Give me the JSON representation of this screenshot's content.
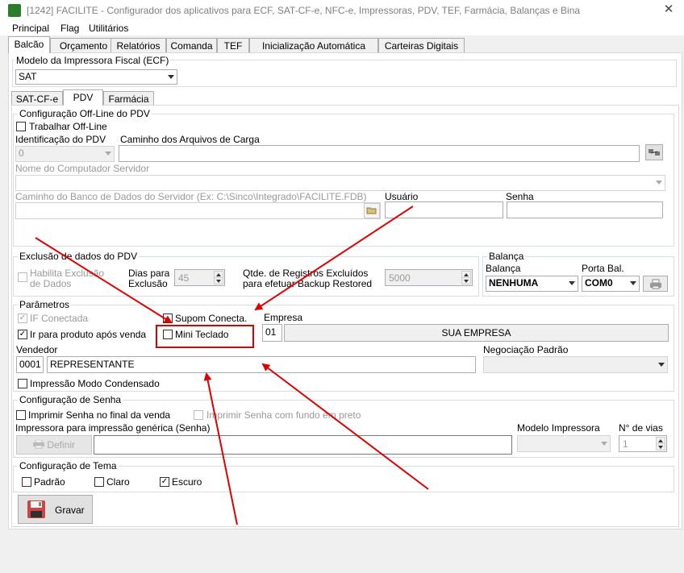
{
  "window": {
    "title": "[1242] FACILITE - Configurador dos aplicativos para ECF, SAT-CF-e, NFC-e, Impressoras, PDV, TEF, Farmácia, Balanças e Bina",
    "close": "✕"
  },
  "menu": [
    "Principal",
    "Flag",
    "Utilitários"
  ],
  "tabs": [
    "Balcão",
    "Orçamento",
    "Relatórios",
    "Comanda",
    "TEF",
    "Inicialização Automática",
    "Carteiras Digitais"
  ],
  "modelo_fiscal": {
    "label": "Modelo da Impressora Fiscal (ECF)",
    "value": "SAT"
  },
  "subtabs": [
    "SAT-CF-e",
    "PDV",
    "Farmácia"
  ],
  "offline": {
    "legend": "Configuração Off-Line do PDV",
    "trabalhar_label": "Trabalhar Off-Line",
    "id_pdv_label": "Identificação do PDV",
    "id_pdv_value": "0",
    "caminho_carga_label": "Caminho dos Arquivos de Carga",
    "nome_servidor_label": "Nome do Computador Servidor",
    "caminho_banco_label": "Caminho do Banco de Dados do Servidor (Ex: C:\\Sinco\\Integrado\\FACILITE.FDB)",
    "usuario_label": "Usuário",
    "senha_label": "Senha"
  },
  "exclusao": {
    "legend": "Exclusão de dados do PDV",
    "habilita_label_1": "Habilita Exclusão",
    "habilita_label_2": "de Dados",
    "dias_label_1": "Dias para",
    "dias_label_2": "Exclusão",
    "dias_value": "45",
    "qtde_label_1": "Qtde. de Registros Excluídos",
    "qtde_label_2": "para efetuar Backup Restored",
    "qtde_value": "5000"
  },
  "balanca": {
    "legend": "Balança",
    "balanca_label": "Balança",
    "balanca_value": "NENHUMA",
    "porta_label": "Porta Bal.",
    "porta_value": "COM0"
  },
  "parametros": {
    "legend": "Parâmetros",
    "if_conectada": "IF Conectada",
    "supom_conecta": "Supom Conecta.",
    "ir_produto": "Ir para produto após venda",
    "mini_teclado": "Mini Teclado",
    "empresa_label": "Empresa",
    "empresa_code": "01",
    "empresa_name": "SUA EMPRESA",
    "vendedor_label": "Vendedor",
    "vendedor_code": "0001",
    "vendedor_name": "REPRESENTANTE",
    "negociacao_label": "Negociação Padrão",
    "impressao_condensado": "Impressão Modo Condensado"
  },
  "senha_cfg": {
    "legend": "Configuração de Senha",
    "imprimir_final": "Imprimir Senha no final da venda",
    "imprimir_fundo": "Imprimir Senha com fundo em preto",
    "impressora_generica": "Impressora para impressão genérica (Senha)",
    "definir": "Definir",
    "modelo_label": "Modelo Impressora",
    "vias_label": "N° de vias",
    "vias_value": "1"
  },
  "tema": {
    "legend": "Configuração de Tema",
    "padrao": "Padrão",
    "claro": "Claro",
    "escuro": "Escuro",
    "checkmark": "✓"
  },
  "gravar": "Gravar",
  "colors": {
    "annotation": "#e00000",
    "brand": "#2a7d2a"
  }
}
